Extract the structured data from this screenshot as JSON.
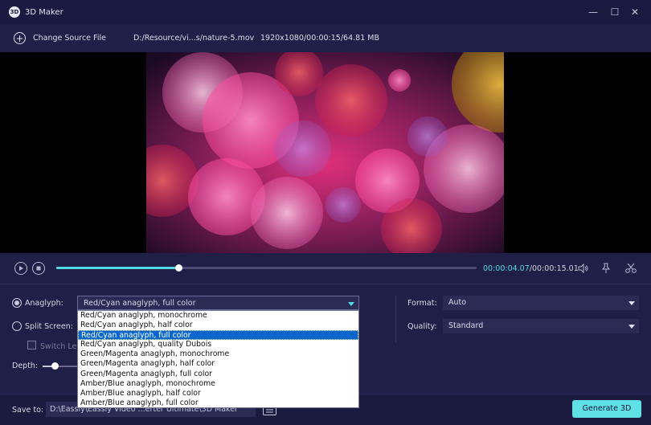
{
  "window": {
    "title": "3D Maker",
    "logo_text": "3D",
    "minimize_glyph": "—",
    "maximize_glyph": "☐",
    "close_glyph": "✕"
  },
  "toolbar": {
    "change_source_label": "Change Source File",
    "file_path": "D:/Resource/vi...s/nature-5.mov",
    "file_info": "1920x1080/00:00:15/64.81 MB"
  },
  "playback": {
    "current_time": "00:00:04.07",
    "separator": "/",
    "total_time": "00:00:15.01",
    "progress": 0.29
  },
  "settings": {
    "anaglyph_label": "Anaglyph:",
    "anaglyph_selected": "Red/Cyan anaglyph, full color",
    "anaglyph_options": [
      "Red/Cyan anaglyph, monochrome",
      "Red/Cyan anaglyph, half color",
      "Red/Cyan anaglyph, full color",
      "Red/Cyan anaglyph, quality Dubois",
      "Green/Magenta anaglyph, monochrome",
      "Green/Magenta anaglyph, half color",
      "Green/Magenta anaglyph, full color",
      "Amber/Blue anaglyph, monochrome",
      "Amber/Blue anaglyph, half color",
      "Amber/Blue anaglyph, full color"
    ],
    "split_screen_label": "Split Screen:",
    "switch_label": "Switch Lef",
    "depth_label": "Depth:",
    "depth_value": 0.25,
    "format_label": "Format:",
    "format_value": "Auto",
    "quality_label": "Quality:",
    "quality_value": "Standard"
  },
  "footer": {
    "save_to_label": "Save to:",
    "save_path": "D:\\Eassiy\\Eassiy Video ...erter Ultimate\\3D Maker",
    "generate_label": "Generate 3D"
  },
  "colors": {
    "accent": "#54d8e0",
    "background": "#1f1f47",
    "selection": "#0a66cc"
  }
}
